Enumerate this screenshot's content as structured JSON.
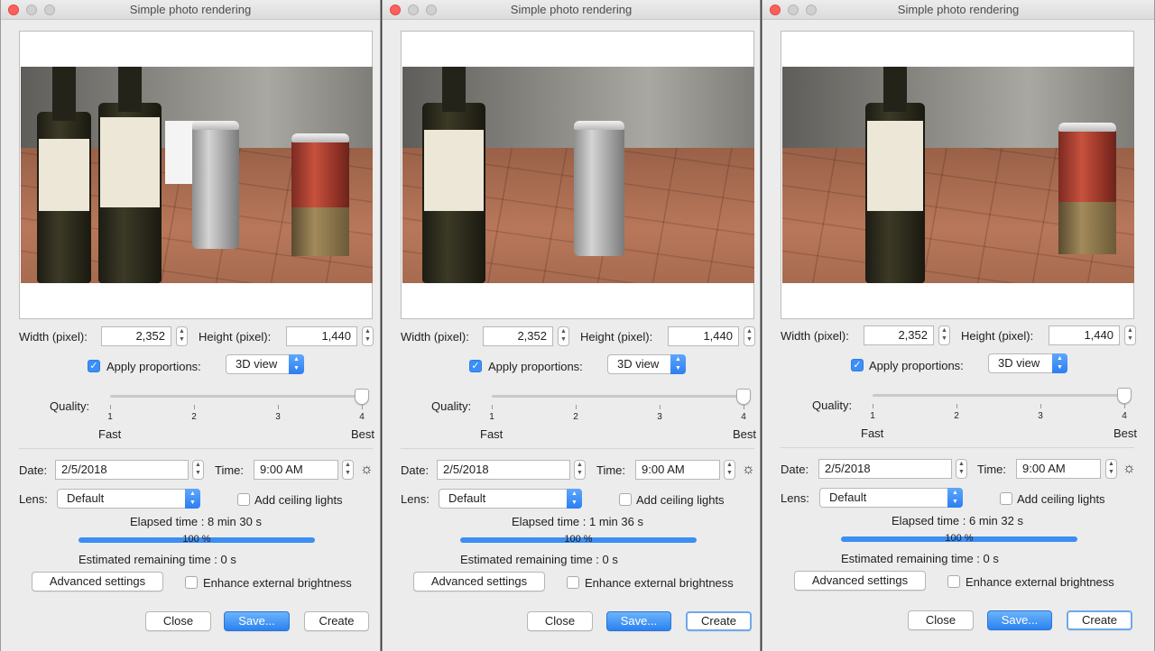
{
  "windows": [
    {
      "title": "Simple photo rendering",
      "width_label": "Width (pixel):",
      "width_value": "2,352",
      "height_label": "Height (pixel):",
      "height_value": "1,440",
      "apply_proportions_label": "Apply proportions:",
      "apply_proportions_checked": true,
      "view_select": "3D view",
      "quality_label": "Quality:",
      "quality_ticks": [
        "1",
        "2",
        "3",
        "4"
      ],
      "quality_level": 4,
      "fast_label": "Fast",
      "best_label": "Best",
      "date_label": "Date:",
      "date_value": "2/5/2018",
      "time_label": "Time:",
      "time_value": "9:00 AM",
      "lens_label": "Lens:",
      "lens_value": "Default",
      "ceiling_lights_label": "Add ceiling lights",
      "elapsed": "Elapsed time : 8 min 30 s",
      "progress_text": "100 %",
      "progress": 1.0,
      "remaining": "Estimated remaining time : 0 s",
      "advanced_label": "Advanced settings",
      "enhance_label": "Enhance external brightness",
      "close_label": "Close",
      "save_label": "Save...",
      "create_label": "Create"
    },
    {
      "title": "Simple photo rendering",
      "width_label": "Width (pixel):",
      "width_value": "2,352",
      "height_label": "Height (pixel):",
      "height_value": "1,440",
      "apply_proportions_label": "Apply proportions:",
      "apply_proportions_checked": true,
      "view_select": "3D view",
      "quality_label": "Quality:",
      "quality_ticks": [
        "1",
        "2",
        "3",
        "4"
      ],
      "quality_level": 4,
      "fast_label": "Fast",
      "best_label": "Best",
      "date_label": "Date:",
      "date_value": "2/5/2018",
      "time_label": "Time:",
      "time_value": "9:00 AM",
      "lens_label": "Lens:",
      "lens_value": "Default",
      "ceiling_lights_label": "Add ceiling lights",
      "elapsed": "Elapsed time : 1 min 36 s",
      "progress_text": "100 %",
      "progress": 1.0,
      "remaining": "Estimated remaining time : 0 s",
      "advanced_label": "Advanced settings",
      "enhance_label": "Enhance external brightness",
      "close_label": "Close",
      "save_label": "Save...",
      "create_label": "Create"
    },
    {
      "title": "Simple photo rendering",
      "width_label": "Width (pixel):",
      "width_value": "2,352",
      "height_label": "Height (pixel):",
      "height_value": "1,440",
      "apply_proportions_label": "Apply proportions:",
      "apply_proportions_checked": true,
      "view_select": "3D view",
      "quality_label": "Quality:",
      "quality_ticks": [
        "1",
        "2",
        "3",
        "4"
      ],
      "quality_level": 4,
      "fast_label": "Fast",
      "best_label": "Best",
      "date_label": "Date:",
      "date_value": "2/5/2018",
      "time_label": "Time:",
      "time_value": "9:00 AM",
      "lens_label": "Lens:",
      "lens_value": "Default",
      "ceiling_lights_label": "Add ceiling lights",
      "elapsed": "Elapsed time : 6 min 32 s",
      "progress_text": "100 %",
      "progress": 1.0,
      "remaining": "Estimated remaining time : 0 s",
      "advanced_label": "Advanced settings",
      "enhance_label": "Enhance external brightness",
      "close_label": "Close",
      "save_label": "Save...",
      "create_label": "Create"
    }
  ],
  "colors": {
    "accent": "#3b8ff6",
    "close_light": "#fc605c",
    "window_bg": "#ececec"
  },
  "icons": {
    "sun": "sun-icon",
    "stepper": "stepper-arrows-icon",
    "popup": "popup-arrows-icon",
    "check": "checkmark-icon"
  }
}
